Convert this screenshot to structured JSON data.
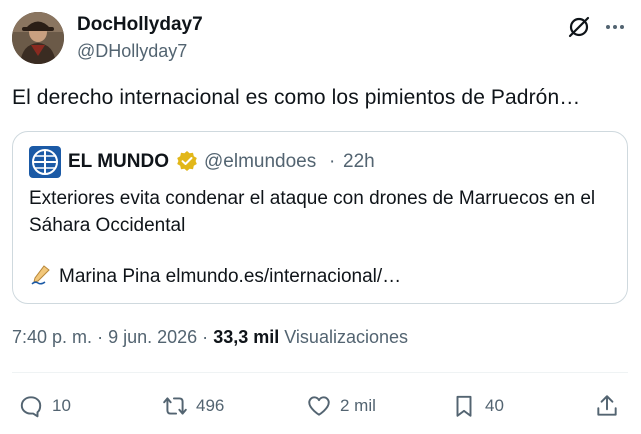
{
  "author": {
    "display_name": "DocHollyday7",
    "handle": "@DHollyday7"
  },
  "tweet": {
    "text": "El derecho internacional es como los pimientos de Padrón…"
  },
  "quoted": {
    "name": "EL MUNDO",
    "handle": "@elmundoes",
    "separator": "·",
    "time": "22h",
    "text": "Exteriores evita condenar el ataque con drones de Marruecos en el Sáhara Occidental",
    "credit": "Marina Pina elmundo.es/internacional/…"
  },
  "meta": {
    "time": "7:40 p. m.",
    "sep1": "·",
    "date": "9 jun. 2026",
    "sep2": "·",
    "views_count": "33,3 mil",
    "views_label": "Visualizaciones"
  },
  "actions": {
    "replies": "10",
    "reposts": "496",
    "likes": "2 mil",
    "bookmarks": "40"
  },
  "icons": [
    "grok-icon",
    "more-icon",
    "verified-icon",
    "writing-hand-icon",
    "reply-icon",
    "retweet-icon",
    "like-icon",
    "bookmark-icon",
    "share-icon"
  ],
  "colors": {
    "text": "#0f1419",
    "secondary": "#536471",
    "border": "#cfd9de",
    "verified": "#e2b719"
  }
}
